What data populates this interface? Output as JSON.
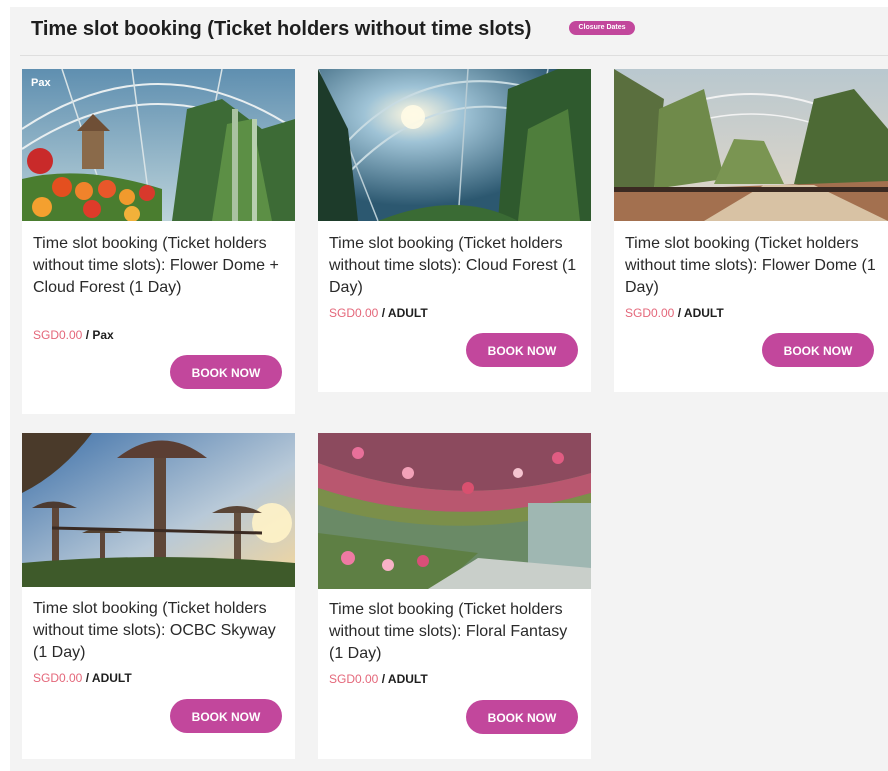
{
  "header": {
    "title": "Time slot booking (Ticket holders without time slots)",
    "badge": "Closure Dates"
  },
  "cards": [
    {
      "image_label": "Pax",
      "title": "Time slot booking (Ticket holders without time slots): Flower Dome + Cloud Forest (1 Day)",
      "price": "SGD0.00",
      "unit": " / Pax",
      "button": "BOOK NOW"
    },
    {
      "title": "Time slot booking (Ticket holders without time slots): Cloud Forest (1 Day)",
      "price": "SGD0.00",
      "unit": " / ADULT",
      "button": "BOOK NOW"
    },
    {
      "title": "Time slot booking (Ticket holders without time slots): Flower Dome (1 Day)",
      "price": "SGD0.00",
      "unit": " / ADULT",
      "button": "BOOK NOW"
    },
    {
      "title": "Time slot booking (Ticket holders without time slots): OCBC Skyway (1 Day)",
      "price": "SGD0.00",
      "unit": " / ADULT",
      "button": "BOOK NOW"
    },
    {
      "title": "Time slot booking (Ticket holders without time slots): Floral Fantasy (1 Day)",
      "price": "SGD0.00",
      "unit": " / ADULT",
      "button": "BOOK NOW"
    }
  ],
  "colors": {
    "accent": "#c2479c",
    "price": "#e4677a",
    "panel_bg": "#f3f3f3"
  }
}
